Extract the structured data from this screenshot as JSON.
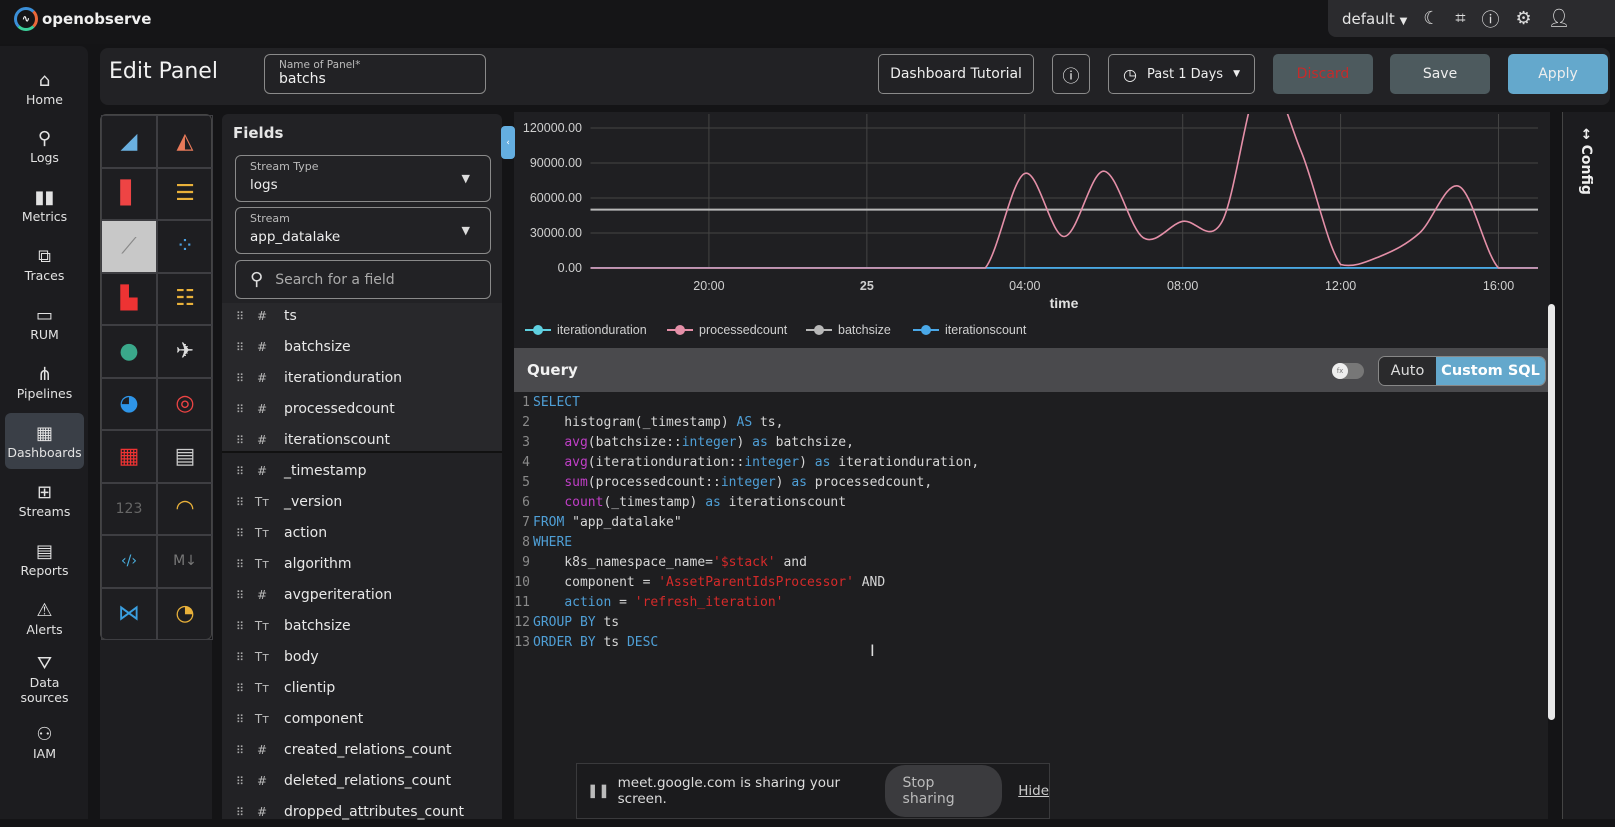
{
  "app": {
    "brand": "openobserve",
    "org": "default"
  },
  "topbar_icons": [
    "moon-icon",
    "slack-icon",
    "help-icon",
    "settings-icon",
    "user-icon"
  ],
  "nav": [
    {
      "label": "Home",
      "icon": "⌂"
    },
    {
      "label": "Logs",
      "icon": "⚲"
    },
    {
      "label": "Metrics",
      "icon": "▮▮"
    },
    {
      "label": "Traces",
      "icon": "⧉"
    },
    {
      "label": "RUM",
      "icon": "▭"
    },
    {
      "label": "Pipelines",
      "icon": "⋔"
    },
    {
      "label": "Dashboards",
      "icon": "▦",
      "active": true
    },
    {
      "label": "Streams",
      "icon": "⊞"
    },
    {
      "label": "Reports",
      "icon": "▤"
    },
    {
      "label": "Alerts",
      "icon": "⚠"
    },
    {
      "label": "Data sources",
      "icon": "⛛"
    },
    {
      "label": "IAM",
      "icon": "⚇"
    }
  ],
  "header": {
    "title": "Edit Panel",
    "panel_name_label": "Name of Panel*",
    "panel_name": "batchs",
    "tutorial": "Dashboard Tutorial",
    "time_range": "Past 1 Days",
    "discard": "Discard",
    "save": "Save",
    "apply": "Apply"
  },
  "chart_types": [
    {
      "name": "area",
      "glyph": "◢",
      "color": "#6ab0e0"
    },
    {
      "name": "area-stacked",
      "glyph": "◭",
      "color": "#e97a5a"
    },
    {
      "name": "bar",
      "glyph": "▋",
      "color": "#e44"
    },
    {
      "name": "h-bar",
      "glyph": "☰",
      "color": "#e9b13a"
    },
    {
      "name": "line",
      "glyph": "⟋",
      "color": "#888",
      "active": true
    },
    {
      "name": "scatter",
      "glyph": "⁘",
      "color": "#4a9fe0"
    },
    {
      "name": "stacked-bar",
      "glyph": "▙",
      "color": "#e33"
    },
    {
      "name": "h-stacked-bar",
      "glyph": "☷",
      "color": "#e9b13a"
    },
    {
      "name": "geomap",
      "glyph": "●",
      "color": "#3aa88a"
    },
    {
      "name": "maps",
      "glyph": "✈",
      "color": "#ddd"
    },
    {
      "name": "pie",
      "glyph": "◕",
      "color": "#2e95e8"
    },
    {
      "name": "donut",
      "glyph": "◎",
      "color": "#e44"
    },
    {
      "name": "heatmap",
      "glyph": "▦",
      "color": "#e33"
    },
    {
      "name": "table",
      "glyph": "▤",
      "color": "#ccc"
    },
    {
      "name": "metric",
      "glyph": "123",
      "color": "#666"
    },
    {
      "name": "gauge",
      "glyph": "◠",
      "color": "#e9b13a"
    },
    {
      "name": "html",
      "glyph": "‹/›",
      "color": "#4ab0e0"
    },
    {
      "name": "markdown",
      "glyph": "M↓",
      "color": "#777"
    },
    {
      "name": "sankey",
      "glyph": "⋈",
      "color": "#3a9fe0"
    },
    {
      "name": "custom-chart",
      "glyph": "◔",
      "color": "#e9b13a"
    }
  ],
  "fields_panel": {
    "title": "Fields",
    "stream_type_label": "Stream Type",
    "stream_type": "logs",
    "stream_label": "Stream",
    "stream": "app_datalake",
    "search_placeholder": "Search for a field",
    "fields": [
      {
        "type": "#",
        "name": "ts"
      },
      {
        "type": "#",
        "name": "batchsize"
      },
      {
        "type": "#",
        "name": "iterationduration"
      },
      {
        "type": "#",
        "name": "processedcount"
      },
      {
        "type": "#",
        "name": "iterationscount"
      },
      {
        "type": "#",
        "name": "_timestamp"
      },
      {
        "type": "Tт",
        "name": "_version"
      },
      {
        "type": "Tт",
        "name": "action"
      },
      {
        "type": "Tт",
        "name": "algorithm"
      },
      {
        "type": "#",
        "name": "avgperiteration"
      },
      {
        "type": "Tт",
        "name": "batchsize"
      },
      {
        "type": "Tт",
        "name": "body"
      },
      {
        "type": "Tт",
        "name": "clientip"
      },
      {
        "type": "Tт",
        "name": "component"
      },
      {
        "type": "#",
        "name": "created_relations_count"
      },
      {
        "type": "#",
        "name": "deleted_relations_count"
      },
      {
        "type": "#",
        "name": "dropped_attributes_count"
      }
    ]
  },
  "chart_data": {
    "type": "line",
    "xlabel": "time",
    "x": [
      "17:00",
      "18:00",
      "19:00",
      "20:00",
      "21:00",
      "22:00",
      "23:00",
      "00:00",
      "01:00",
      "02:00",
      "03:00",
      "04:00",
      "05:00",
      "06:00",
      "07:00",
      "08:00",
      "09:00",
      "10:00",
      "11:00",
      "12:00",
      "13:00",
      "14:00",
      "15:00",
      "16:00",
      "17:00"
    ],
    "x_ticks": [
      {
        "label": "20:00",
        "at": "20:00"
      },
      {
        "label": "25",
        "at": "00:00",
        "bold": true
      },
      {
        "label": "04:00",
        "at": "04:00"
      },
      {
        "label": "08:00",
        "at": "08:00"
      },
      {
        "label": "12:00",
        "at": "12:00"
      },
      {
        "label": "16:00",
        "at": "16:00"
      }
    ],
    "y_ticks": [
      "0.00",
      "30000.00",
      "60000.00",
      "90000.00",
      "120000.00"
    ],
    "ylim": [
      0,
      120000
    ],
    "grid": true,
    "legend_position": "bottom-left",
    "series": [
      {
        "name": "iterationduration",
        "color": "#5fd0e0",
        "values": [
          0,
          0,
          0,
          0,
          0,
          0,
          0,
          0,
          0,
          0,
          0,
          0,
          0,
          0,
          0,
          0,
          0,
          0,
          0,
          0,
          0,
          0,
          0,
          0,
          0
        ]
      },
      {
        "name": "processedcount",
        "color": "#e48fa8",
        "values": [
          0,
          0,
          0,
          0,
          0,
          0,
          0,
          0,
          0,
          0,
          0,
          81000,
          27000,
          83000,
          26000,
          40000,
          40000,
          165000,
          100000,
          3000,
          10000,
          30000,
          70000,
          0,
          0
        ]
      },
      {
        "name": "batchsize",
        "color": "#b8b8b8",
        "values": [
          50000,
          50000,
          50000,
          50000,
          50000,
          50000,
          50000,
          50000,
          50000,
          50000,
          50000,
          50000,
          50000,
          50000,
          50000,
          50000,
          50000,
          50000,
          50000,
          50000,
          50000,
          50000,
          50000,
          50000,
          50000
        ]
      },
      {
        "name": "iterationscount",
        "color": "#4aa8e8",
        "values": [
          200,
          200,
          200,
          200,
          200,
          200,
          200,
          200,
          200,
          200,
          200,
          200,
          200,
          200,
          200,
          200,
          200,
          200,
          200,
          200,
          200,
          200,
          200,
          200,
          200
        ]
      }
    ]
  },
  "query": {
    "title": "Query",
    "mode_auto": "Auto",
    "mode_custom": "Custom SQL",
    "toggle_icon": "fx",
    "lines": [
      [
        {
          "t": "SELECT",
          "c": "kw"
        }
      ],
      [
        {
          "t": "    histogram(_timestamp) ",
          "c": "plain"
        },
        {
          "t": "AS",
          "c": "kw"
        },
        {
          "t": " ts,",
          "c": "plain"
        }
      ],
      [
        {
          "t": "    ",
          "c": "plain"
        },
        {
          "t": "avg",
          "c": "fn"
        },
        {
          "t": "(batchsize::",
          "c": "plain"
        },
        {
          "t": "integer",
          "c": "kw"
        },
        {
          "t": ") ",
          "c": "plain"
        },
        {
          "t": "as",
          "c": "kw"
        },
        {
          "t": " batchsize,",
          "c": "plain"
        }
      ],
      [
        {
          "t": "    ",
          "c": "plain"
        },
        {
          "t": "avg",
          "c": "fn"
        },
        {
          "t": "(iterationduration::",
          "c": "plain"
        },
        {
          "t": "integer",
          "c": "kw"
        },
        {
          "t": ") ",
          "c": "plain"
        },
        {
          "t": "as",
          "c": "kw"
        },
        {
          "t": " iterationduration,",
          "c": "plain"
        }
      ],
      [
        {
          "t": "    ",
          "c": "plain"
        },
        {
          "t": "sum",
          "c": "fn"
        },
        {
          "t": "(processedcount::",
          "c": "plain"
        },
        {
          "t": "integer",
          "c": "kw"
        },
        {
          "t": ") ",
          "c": "plain"
        },
        {
          "t": "as",
          "c": "kw"
        },
        {
          "t": " processedcount,",
          "c": "plain"
        }
      ],
      [
        {
          "t": "    ",
          "c": "plain"
        },
        {
          "t": "count",
          "c": "fn"
        },
        {
          "t": "(_timestamp) ",
          "c": "plain"
        },
        {
          "t": "as",
          "c": "kw"
        },
        {
          "t": " iterationscount",
          "c": "plain"
        }
      ],
      [
        {
          "t": "FROM",
          "c": "kw"
        },
        {
          "t": " \"app_datalake\"",
          "c": "plain"
        }
      ],
      [
        {
          "t": "WHERE",
          "c": "kw"
        }
      ],
      [
        {
          "t": "    k8s_namespace_name=",
          "c": "plain"
        },
        {
          "t": "'$stack'",
          "c": "str"
        },
        {
          "t": " and",
          "c": "plain"
        }
      ],
      [
        {
          "t": "    component = ",
          "c": "plain"
        },
        {
          "t": "'AssetParentIdsProcessor'",
          "c": "str"
        },
        {
          "t": " AND",
          "c": "plain"
        }
      ],
      [
        {
          "t": "    ",
          "c": "plain"
        },
        {
          "t": "action",
          "c": "kw"
        },
        {
          "t": " = ",
          "c": "plain"
        },
        {
          "t": "'refresh_iteration'",
          "c": "str"
        }
      ],
      [
        {
          "t": "GROUP BY",
          "c": "kw"
        },
        {
          "t": " ts",
          "c": "plain"
        }
      ],
      [
        {
          "t": "ORDER BY",
          "c": "kw"
        },
        {
          "t": " ts ",
          "c": "plain"
        },
        {
          "t": "DESC",
          "c": "kw"
        }
      ]
    ]
  },
  "config_label": "Config",
  "screen_share": {
    "message": "meet.google.com is sharing your screen.",
    "stop": "Stop sharing",
    "hide": "Hide"
  }
}
